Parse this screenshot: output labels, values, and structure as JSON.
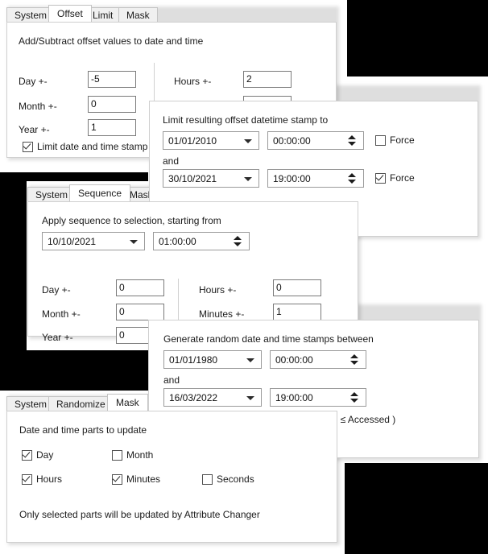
{
  "panels": {
    "offset": {
      "tabs": [
        "System",
        "Offset",
        "Limit",
        "Mask"
      ],
      "active_tab": "Offset",
      "heading": "Add/Subtract offset values to date and time",
      "fields": [
        {
          "label": "Day +-",
          "value": "-5"
        },
        {
          "label": "Month +-",
          "value": "0"
        },
        {
          "label": "Year +-",
          "value": "1"
        },
        {
          "label": "Hours +-",
          "value": "2"
        }
      ],
      "checkbox": {
        "label": "Limit date and time stamp",
        "checked": true
      }
    },
    "limit": {
      "tabs": [
        "System",
        "Offset",
        "Limit",
        "Mask"
      ],
      "active_tab": "Limit",
      "heading": "Limit resulting offset datetime stamp to",
      "and_label": "and",
      "rows": [
        {
          "date": "01/01/2010",
          "time": "00:00:00",
          "force_label": "Force",
          "force_checked": false
        },
        {
          "date": "30/10/2021",
          "time": "19:00:00",
          "force_label": "Force",
          "force_checked": true
        }
      ]
    },
    "sequence": {
      "tabs": [
        "System",
        "Sequence",
        "Mask"
      ],
      "active_tab": "Sequence",
      "heading": "Apply sequence to selection, starting from",
      "start_date": "10/10/2021",
      "start_time": "01:00:00",
      "fields": [
        {
          "label": "Day +-",
          "value": "0"
        },
        {
          "label": "Month +-",
          "value": "0"
        },
        {
          "label": "Year +-",
          "value": "0"
        },
        {
          "label": "Hours +-",
          "value": "0"
        },
        {
          "label": "Minutes +-",
          "value": "1"
        }
      ]
    },
    "randomize": {
      "tabs": [
        "System",
        "Randomize",
        "Mask"
      ],
      "active_tab": "Randomize",
      "heading": "Generate random date and time stamps between",
      "and_label": "and",
      "from_date": "01/01/1980",
      "from_time": "00:00:00",
      "to_date": "16/03/2022",
      "to_time": "19:00:00",
      "strict": {
        "label": "Use strict mode ( Created ≤ Modified ≤ Accessed )",
        "checked": true
      }
    },
    "mask": {
      "tabs": [
        "System",
        "Randomize",
        "Mask"
      ],
      "active_tab": "Mask",
      "heading": "Date and time parts to update",
      "checkboxes": [
        {
          "label": "Day",
          "checked": true
        },
        {
          "label": "Month",
          "checked": false
        },
        {
          "label": "Hours",
          "checked": true
        },
        {
          "label": "Minutes",
          "checked": true
        },
        {
          "label": "Seconds",
          "checked": false
        }
      ],
      "footer": "Only selected parts will be updated by Attribute Changer"
    }
  }
}
